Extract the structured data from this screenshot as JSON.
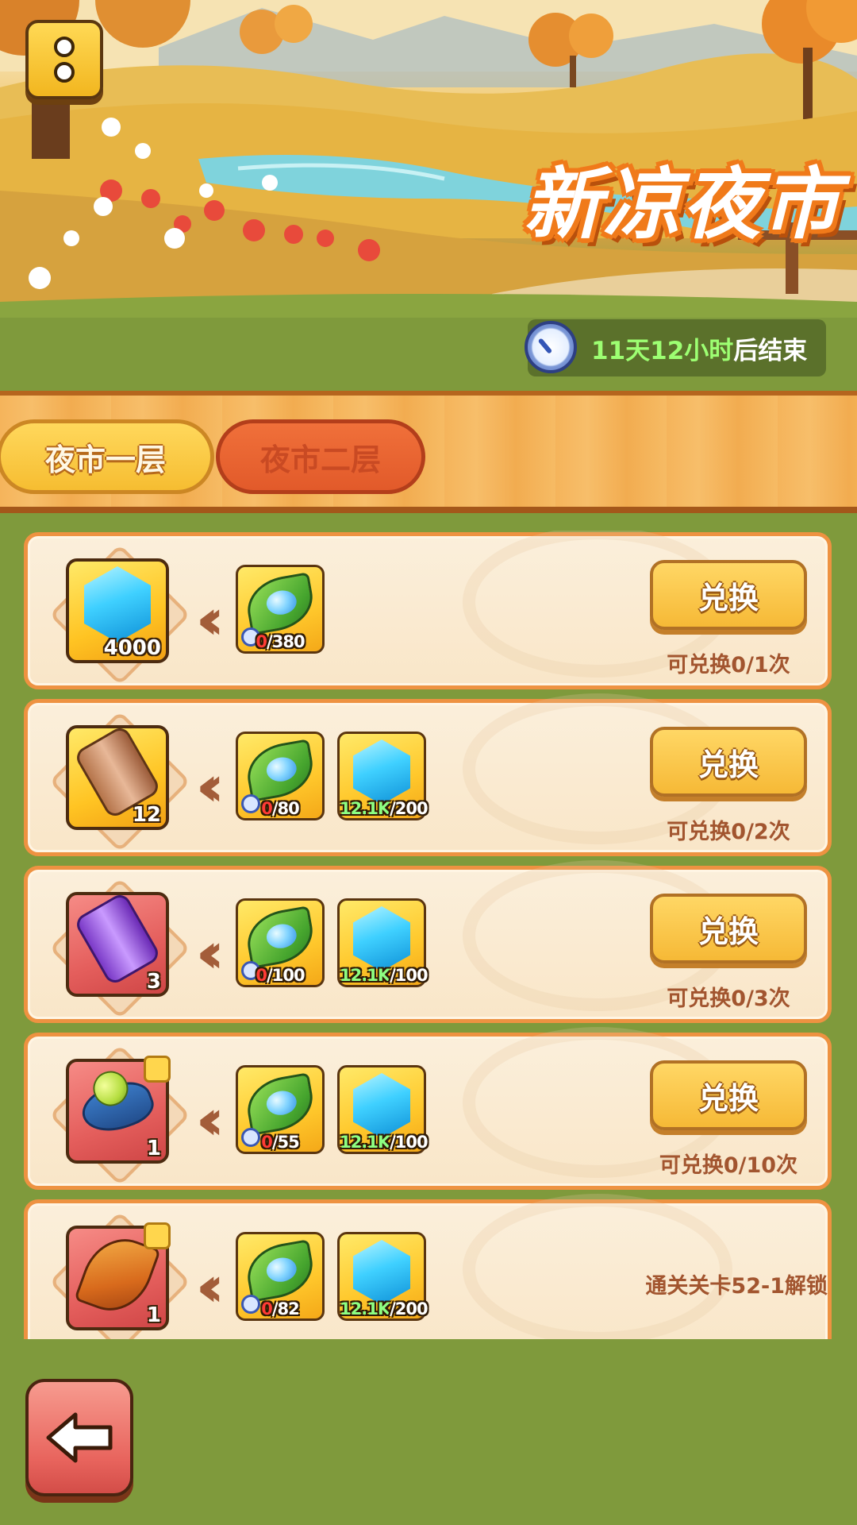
{
  "event": {
    "title": "新凉夜市",
    "timer_value": "11天12小时",
    "timer_suffix": "后结束"
  },
  "tabs": [
    {
      "label": "夜市一层",
      "selected": true
    },
    {
      "label": "夜市二层",
      "selected": false
    }
  ],
  "rows": [
    {
      "reward": {
        "icon": "blue-gem-icon",
        "qty": "4000",
        "frame": "gold"
      },
      "costs": [
        {
          "icon": "leaf-token-icon",
          "have": "0",
          "need": "/380"
        }
      ],
      "button": "兑换",
      "limit": "可兑换0/1次"
    },
    {
      "reward": {
        "icon": "brown-scroll-icon",
        "qty": "12",
        "frame": "gold"
      },
      "costs": [
        {
          "icon": "leaf-token-icon",
          "have": "0",
          "need": "/80"
        },
        {
          "icon": "blue-gem-icon",
          "have": "12.1K",
          "need": "/200"
        }
      ],
      "button": "兑换",
      "limit": "可兑换0/2次"
    },
    {
      "reward": {
        "icon": "purple-scroll-icon",
        "qty": "3",
        "frame": "red"
      },
      "costs": [
        {
          "icon": "leaf-token-icon",
          "have": "0",
          "need": "/100"
        },
        {
          "icon": "blue-gem-icon",
          "have": "12.1K",
          "need": "/100"
        }
      ],
      "button": "兑换",
      "limit": "可兑换0/3次"
    },
    {
      "reward": {
        "icon": "seed-pod-fragment-icon",
        "qty": "1",
        "frame": "red"
      },
      "costs": [
        {
          "icon": "leaf-token-icon",
          "have": "0",
          "need": "/55"
        },
        {
          "icon": "blue-gem-icon",
          "have": "12.1K",
          "need": "/100"
        }
      ],
      "button": "兑换",
      "limit": "可兑换0/10次"
    },
    {
      "reward": {
        "icon": "autumn-leaf-fragment-icon",
        "qty": "1",
        "frame": "red"
      },
      "costs": [
        {
          "icon": "leaf-token-icon",
          "have": "0",
          "need": "/82"
        },
        {
          "icon": "blue-gem-icon",
          "have": "12.1K",
          "need": "/200"
        }
      ],
      "unlock_text": "通关关卡52-1解锁"
    }
  ],
  "colors": {
    "accent_orange": "#ee9241",
    "button_gold": "#f6b936",
    "insufficient_red": "#ff3b35",
    "sufficient_green": "#8dff82",
    "label_brown": "#a2552f"
  }
}
